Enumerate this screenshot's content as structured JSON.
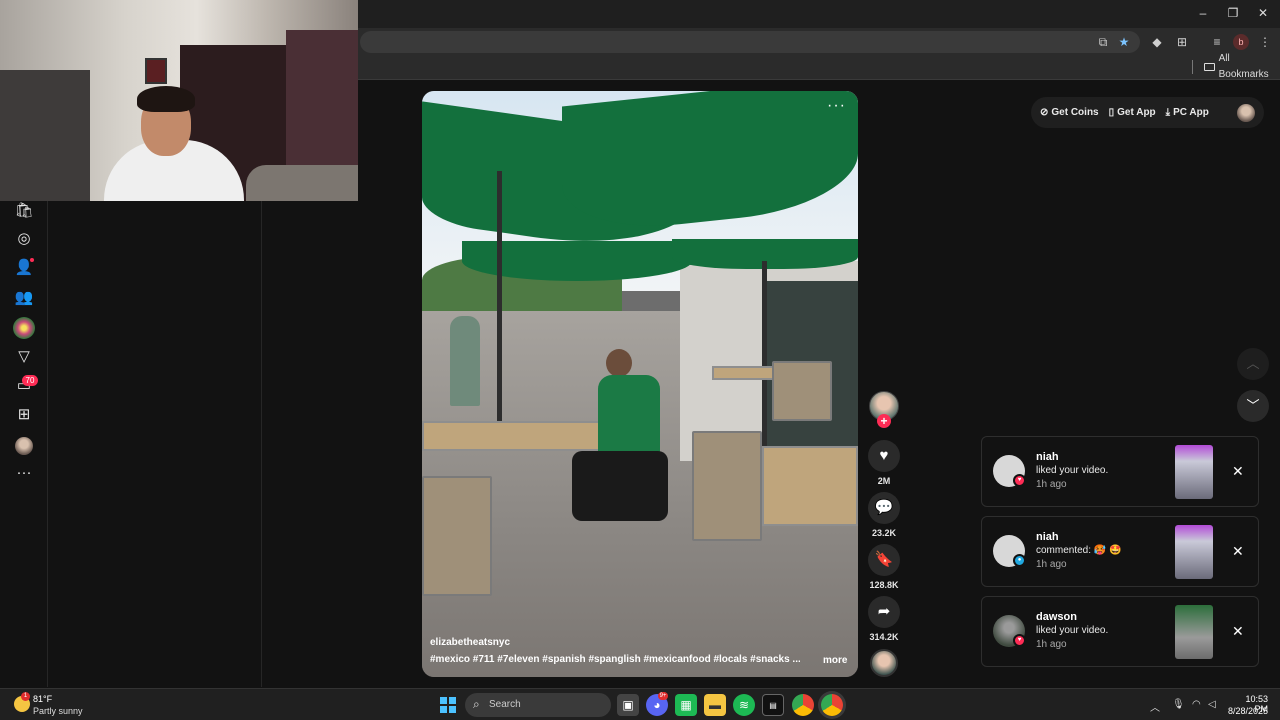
{
  "browser": {
    "bookmarks_label": "All Bookmarks",
    "profile_initial": "b",
    "window_controls": [
      "–",
      "❐",
      "✕"
    ]
  },
  "sidebar": {
    "messages_badge": "70"
  },
  "video": {
    "author": "elizabetheatsnyc",
    "hashtags": "#mexico #711 #7eleven #spanish #spanglish #mexicanfood #locals #snacks ...",
    "more_label": "more",
    "menu_dots": "···"
  },
  "actions": {
    "likes": "2M",
    "comments": "23.2K",
    "saves": "128.8K",
    "shares": "314.2K"
  },
  "top_actions": {
    "coins": "Get Coins",
    "app": "Get App",
    "pc_app": "PC App"
  },
  "notifications": [
    {
      "name": "niah",
      "text": "liked your video.",
      "time": "1h ago",
      "badge_color": "#fe2c55"
    },
    {
      "name": "niah",
      "text": "commented: 🥵 🤩",
      "time": "1h ago",
      "badge_color": "#20a8e0"
    },
    {
      "name": "dawson",
      "text": "liked your video.",
      "time": "1h ago",
      "badge_color": "#fe2c55"
    }
  ],
  "taskbar": {
    "weather_temp": "81°F",
    "weather_desc": "Partly sunny",
    "weather_badge": "1",
    "search_placeholder": "Search",
    "discord_badge": "9+",
    "time": "10:53 PM",
    "date": "8/28/2025"
  },
  "colors": {
    "accent": "#fe2c55",
    "background": "#121212"
  }
}
